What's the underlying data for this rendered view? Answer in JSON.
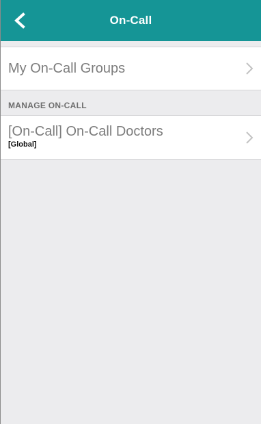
{
  "header": {
    "title": "On-Call",
    "back_icon": "chevron-left-icon",
    "background_color": "#159596"
  },
  "my_groups": {
    "label": "My On-Call Groups",
    "chevron_icon": "chevron-right-icon"
  },
  "manage_section": {
    "header": "MANAGE ON-CALL",
    "items": [
      {
        "label": "[On-Call] On-Call Doctors",
        "sublabel": "[Global]",
        "chevron_icon": "chevron-right-icon"
      }
    ]
  }
}
